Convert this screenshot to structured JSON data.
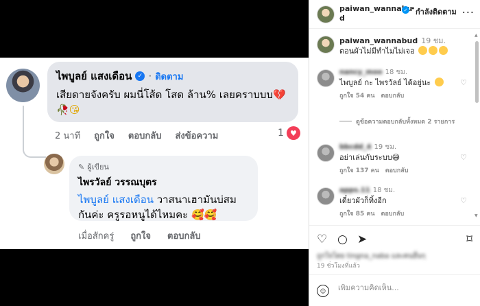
{
  "screenshot": {
    "comment1": {
      "name": "ไพบูลย์ แสงเดือน",
      "dot": "·",
      "follow": "ติดตาม",
      "text": "เสียดายจังครับ ผมนี่โส้ด โสด ล้าน% เลยคราบบบ",
      "emoji_heartbreak": "💔",
      "emoji_rose": "🥀",
      "emoji_kiss": "😘",
      "time": "2 นาที",
      "like": "ถูกใจ",
      "reply": "ตอบกลับ",
      "send": "ส่งข้อความ",
      "reaction_count": "1"
    },
    "comment2": {
      "badge": "ผู้เขียน",
      "name": "ไพรวัลย์ วรรณบุตร",
      "mention": "ไพบูลย์ แสงเดือน",
      "text": " วาสนาเฮามันบ่สมกันค่ะ ครูรอหนูได้ไหมคะ 🥰🥰",
      "time": "เมื่อสักครู่",
      "like": "ถูกใจ",
      "reply": "ตอบกลับ"
    }
  },
  "instagram": {
    "header": {
      "username": "paiwan_wannabud",
      "dot": "•",
      "follow_status": "กำลังติดตาม",
      "more": "..."
    },
    "caption": {
      "username": "paiwan_wannabud",
      "time": "19 ชม.",
      "text": "ตอนผัวไม่มีทำไมไม่เจอ"
    },
    "comments": [
      {
        "user": "nancy_moo",
        "time": "18 ชม.",
        "text": "ไพบูลย์ กะ ไพรวัลย์ ได้อยู่นะ",
        "likes": "ถูกใจ 54 คน",
        "reply": "ตอบกลับ"
      },
      {
        "user": "bbcdd_4",
        "time": "19 ชม.",
        "text": "อย่าเล่นกับระบบ😅",
        "likes": "ถูกใจ 137 คน",
        "reply": "ตอบกลับ"
      },
      {
        "user": "apps.11",
        "time": "18 ชม.",
        "text": "เดี๋ยวผัวก็ทิ้งอีก",
        "likes": "ถูกใจ 85 คน",
        "reply": "ตอบกลับ"
      }
    ],
    "view_replies": "ดูข้อความตอบกลับทั้งหมด 2 รายการ",
    "likes_line": "ถูกใจโดย tingna_naba และคนอื่นๆ",
    "post_time": "19 ชั่วโมงที่แล้ว",
    "comment_placeholder": "เพิ่มความคิดเห็น..."
  }
}
